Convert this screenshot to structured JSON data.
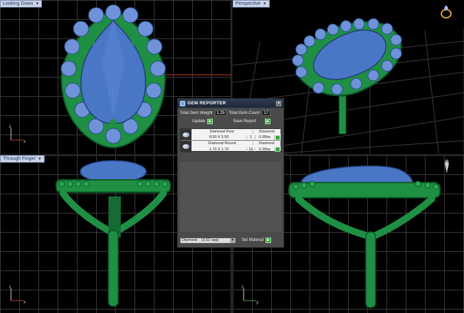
{
  "viewports": {
    "top_left": {
      "label": "Looking Down"
    },
    "top_right": {
      "label": "Perspective"
    },
    "bottom_left": {
      "label": "Through Finger"
    },
    "bottom_right": {
      "label": ""
    }
  },
  "icons": {
    "viewport_menu": "dropdown-arrow-icon",
    "ring_preview": "ring-icon",
    "pendant_preview": "pendant-icon"
  },
  "colors": {
    "metal": "#22a04a",
    "gem": "#4a76c6",
    "grid": "#3a3a3a",
    "background": "#000000",
    "label_bg": "#c9d4e6"
  },
  "gem_reporter": {
    "title": "GEM REPORTER",
    "close": "×",
    "total_weight_label": "Total Gem Weight",
    "total_weight_value": "1.25",
    "total_count_label": "Total Gem Count",
    "total_count_value": "17",
    "update_label": "Update",
    "save_report_label": "Save Report",
    "gems": [
      {
        "name": "Diamond Pear",
        "material": "Diamond",
        "size": "8.50 X 5.50",
        "count": "1",
        "weight": "0.95tw"
      },
      {
        "name": "Diamond Round",
        "material": "Diamond",
        "size": "1.70 X 1.70",
        "count": "16",
        "weight": "0.30tw"
      }
    ],
    "material_select": "Diamond",
    "material_spg": "(3.52 spg)",
    "set_material_label": "Set Material"
  }
}
